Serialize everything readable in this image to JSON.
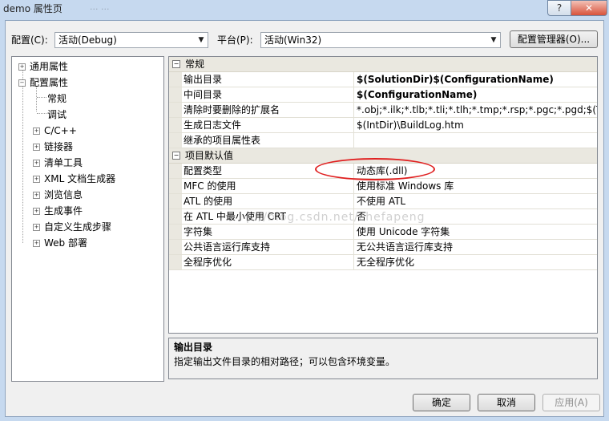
{
  "window": {
    "title": "demo 属性页",
    "title_ghost": "... ...",
    "help_label": "?",
    "close_label": "✕"
  },
  "toolbar": {
    "config_label": "配置(C):",
    "config_value": "活动(Debug)",
    "platform_label": "平台(P):",
    "platform_value": "活动(Win32)",
    "config_manager_label": "配置管理器(O)..."
  },
  "tree": {
    "items": [
      {
        "label": "通用属性",
        "expander": "+"
      },
      {
        "label": "配置属性",
        "expander": "−"
      },
      {
        "label": "常规",
        "expander": ""
      },
      {
        "label": "调试",
        "expander": ""
      },
      {
        "label": "C/C++",
        "expander": "+"
      },
      {
        "label": "链接器",
        "expander": "+"
      },
      {
        "label": "清单工具",
        "expander": "+"
      },
      {
        "label": "XML 文档生成器",
        "expander": "+"
      },
      {
        "label": "浏览信息",
        "expander": "+"
      },
      {
        "label": "生成事件",
        "expander": "+"
      },
      {
        "label": "自定义生成步骤",
        "expander": "+"
      },
      {
        "label": "Web 部署",
        "expander": "+"
      }
    ]
  },
  "grid": {
    "collapse_glyph": "−",
    "categories": [
      {
        "title": "常规",
        "rows": [
          {
            "name": "输出目录",
            "value": "$(SolutionDir)$(ConfigurationName)",
            "bold": true
          },
          {
            "name": "中间目录",
            "value": "$(ConfigurationName)",
            "bold": true
          },
          {
            "name": "清除时要删除的扩展名",
            "value": "*.obj;*.ilk;*.tlb;*.tli;*.tlh;*.tmp;*.rsp;*.pgc;*.pgd;$(TargetPath)",
            "bold": false
          },
          {
            "name": "生成日志文件",
            "value": "$(IntDir)\\BuildLog.htm",
            "bold": false
          },
          {
            "name": "继承的项目属性表",
            "value": "",
            "bold": false
          }
        ]
      },
      {
        "title": "项目默认值",
        "rows": [
          {
            "name": "配置类型",
            "value": "动态库(.dll)",
            "bold": false
          },
          {
            "name": "MFC 的使用",
            "value": "使用标准 Windows 库",
            "bold": false
          },
          {
            "name": "ATL 的使用",
            "value": "不使用 ATL",
            "bold": false
          },
          {
            "name": "在 ATL 中最小使用 CRT",
            "value": "否",
            "bold": false
          },
          {
            "name": "字符集",
            "value": "使用 Unicode 字符集",
            "bold": false
          },
          {
            "name": "公共语言运行库支持",
            "value": "无公共语言运行库支持",
            "bold": false
          },
          {
            "name": "全程序优化",
            "value": "无全程序优化",
            "bold": false
          }
        ]
      }
    ]
  },
  "description": {
    "title": "输出目录",
    "text": "指定输出文件目录的相对路径；可以包含环境变量。"
  },
  "watermark": "p://blog.csdn.net/chefapeng",
  "buttons": {
    "ok": "确定",
    "cancel": "取消",
    "apply": "应用(A)"
  },
  "colors": {
    "annotation": "#e02020",
    "category_bg": "#eae8e0"
  }
}
